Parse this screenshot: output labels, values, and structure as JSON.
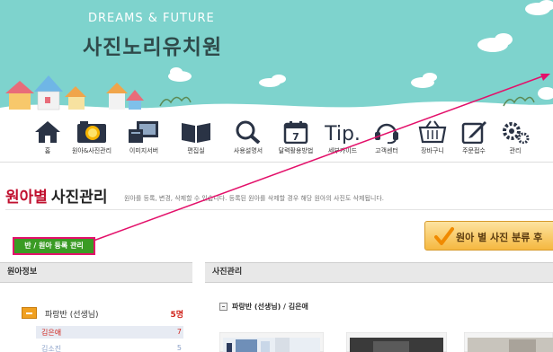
{
  "header": {
    "subtitle": "DREAMS & FUTURE",
    "title": "사진노리유치원"
  },
  "nav": [
    {
      "label": "홈",
      "icon": "home-icon"
    },
    {
      "label": "원아&사진관리",
      "icon": "camera-icon"
    },
    {
      "label": "이미지서버",
      "icon": "server-icon"
    },
    {
      "label": "편집실",
      "icon": "book-icon"
    },
    {
      "label": "사용설명서",
      "icon": "magnifier-icon"
    },
    {
      "label": "달력활용방법",
      "icon": "calendar-icon",
      "calendar_day": "7"
    },
    {
      "label": "세부가이드",
      "icon": "tip-icon",
      "icon_text": "Tip."
    },
    {
      "label": "고객센터",
      "icon": "headset-icon"
    },
    {
      "label": "장바구니",
      "icon": "cart-icon"
    },
    {
      "label": "주문접수",
      "icon": "order-edit-icon"
    },
    {
      "label": "관리",
      "icon": "gears-icon"
    }
  ],
  "page": {
    "title_red": "원아별",
    "title_dark": "사진관리",
    "description": "원아를 등록, 변경, 삭제할 수 있습니다. 등록된 원아를 삭제할 경우 해당 원아의 사진도 삭제됩니다."
  },
  "buttons": {
    "manage_class": "반 / 원아 등록 관리",
    "sort_photos": "원아 별 사진 분류 후"
  },
  "left_panel": {
    "title": "원아정보",
    "group": {
      "label": "파랑반 (선생님)",
      "count": "5명"
    },
    "students": [
      {
        "name": "김은애",
        "count": "7"
      },
      {
        "name": "김소진",
        "count": "5"
      }
    ]
  },
  "right_panel": {
    "title": "사진관리",
    "breadcrumb": "파랑반 (선생님) / 김은애"
  },
  "colors": {
    "banner": "#7ed3cd",
    "accent_red": "#c0102f",
    "button_green": "#3a9b24",
    "highlight_pink": "#e3106a",
    "orange": "#f5b840"
  }
}
